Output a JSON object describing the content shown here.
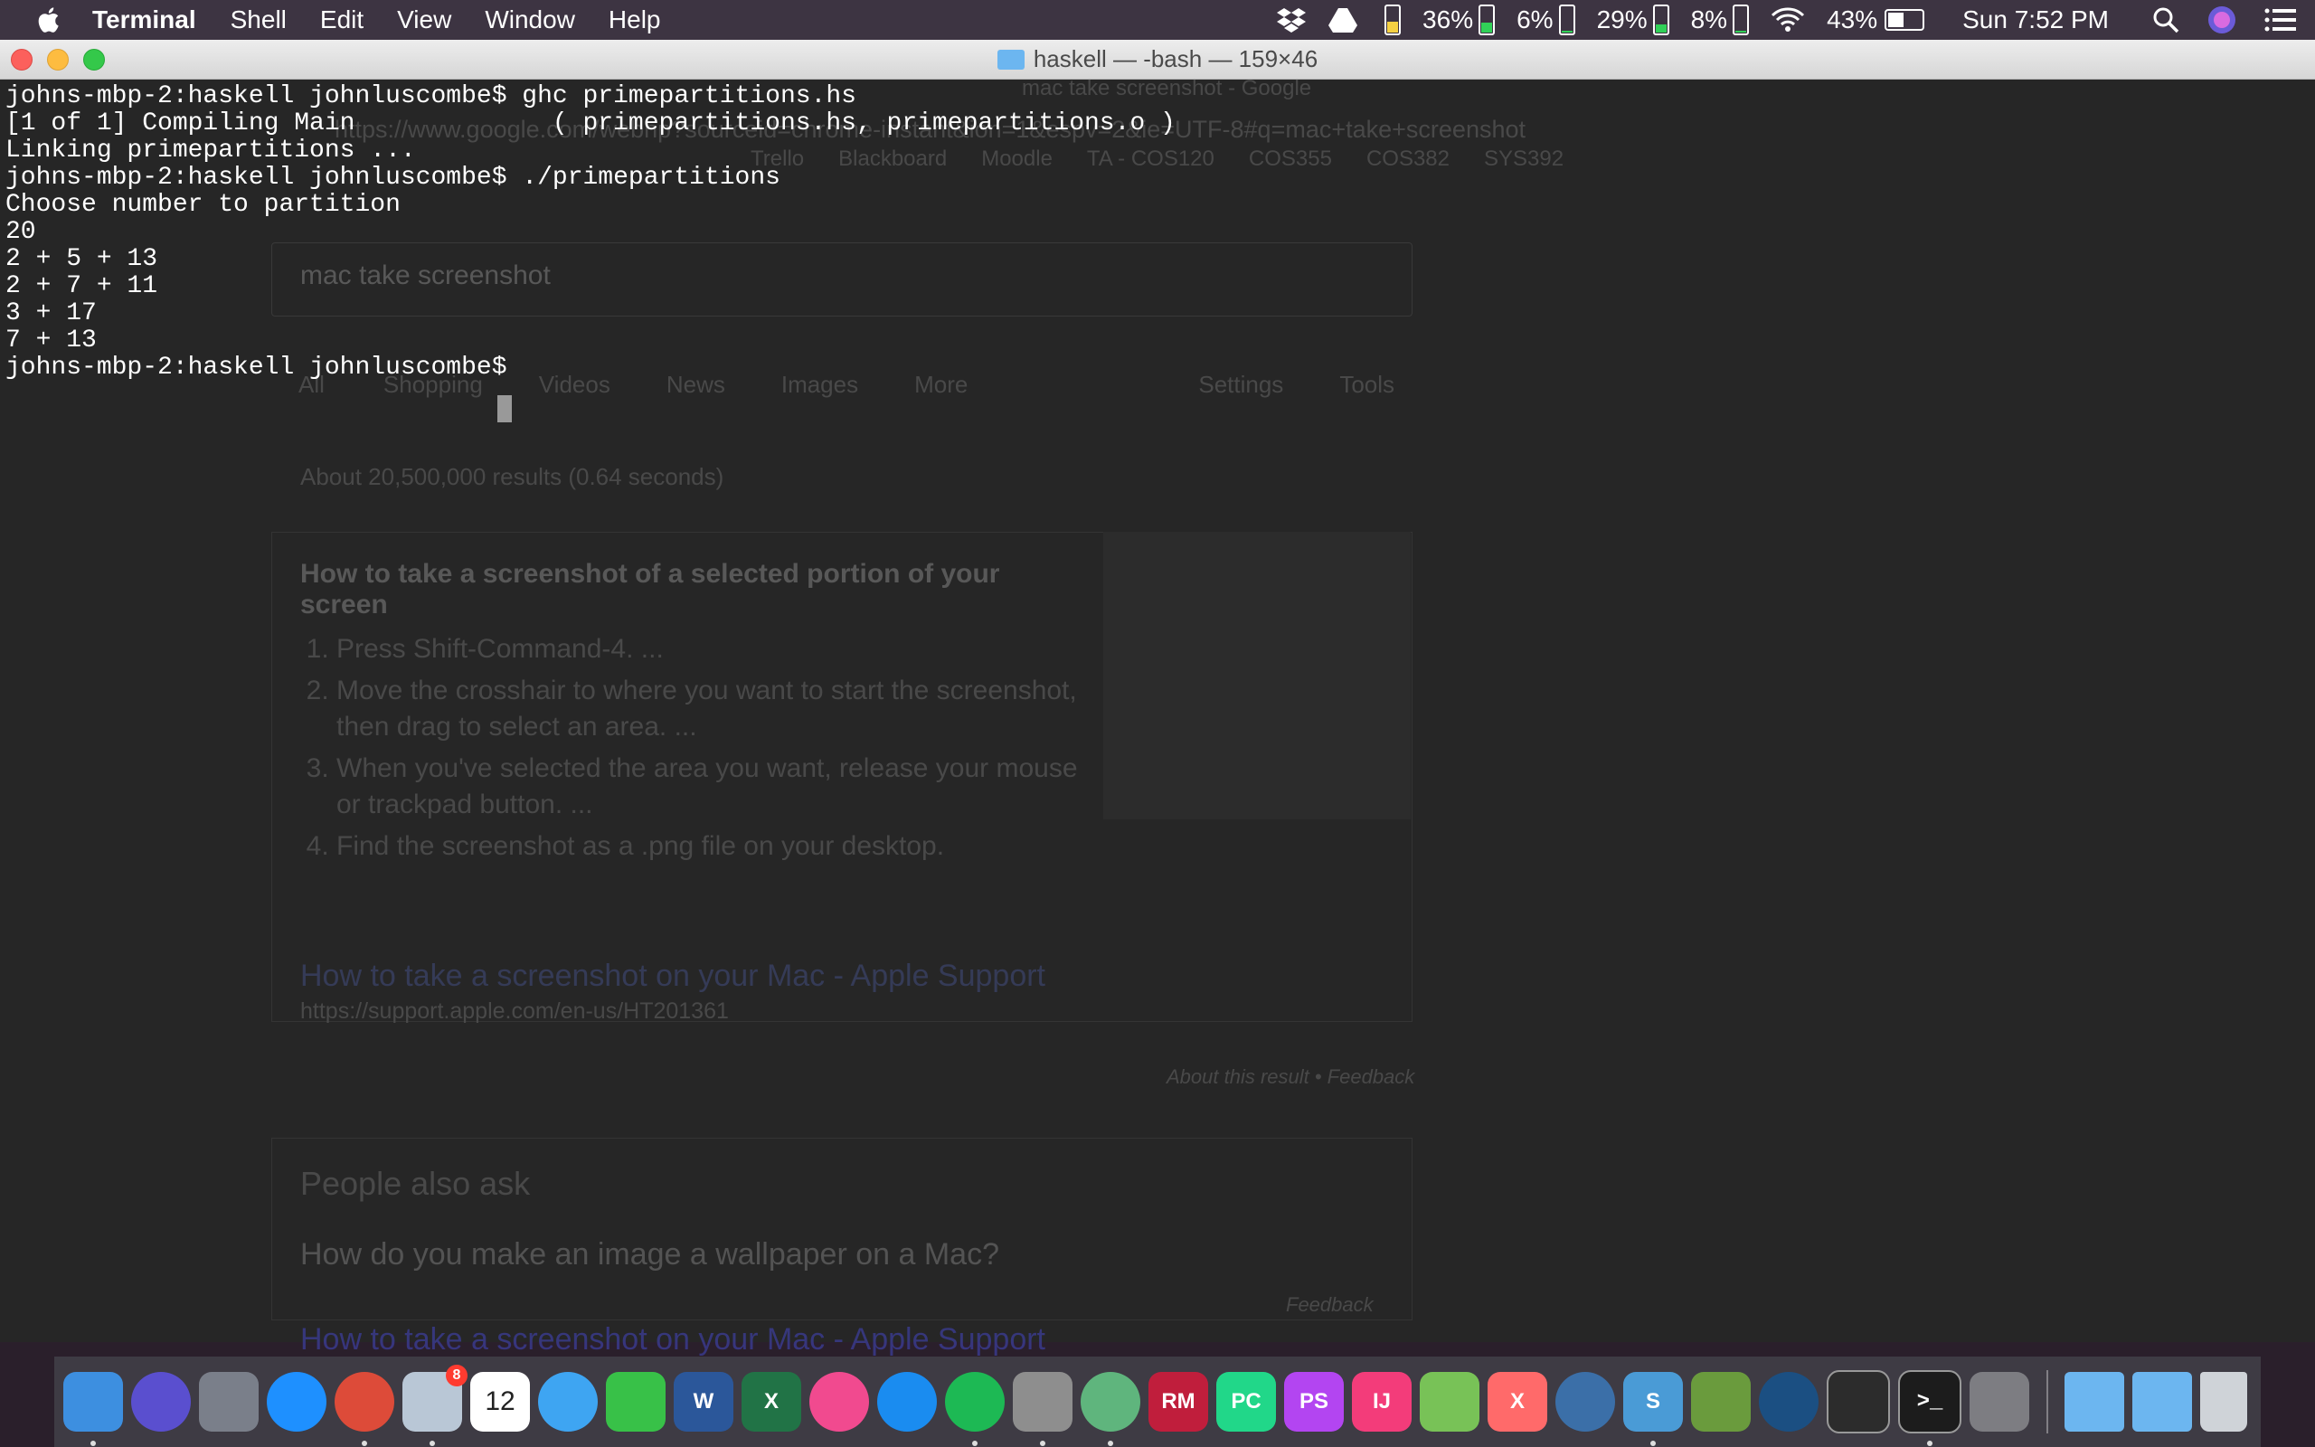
{
  "menubar": {
    "app_name": "Terminal",
    "items": [
      "Shell",
      "Edit",
      "View",
      "Window",
      "Help"
    ],
    "status": {
      "battery1": "36%",
      "battery2": "6%",
      "battery3": "29%",
      "battery4": "8%",
      "main_battery": "43%",
      "clock": "Sun 7:52 PM"
    },
    "icons": [
      "apple-logo",
      "dropbox-icon",
      "drive-icon",
      "wifi-icon",
      "spotlight-icon",
      "siri-icon",
      "notification-center-icon"
    ]
  },
  "window": {
    "title": "haskell — -bash — 159×46"
  },
  "terminal": {
    "lines": [
      "johns-mbp-2:haskell johnluscombe$ ghc primepartitions.hs",
      "[1 of 1] Compiling Main             ( primepartitions.hs, primepartitions.o )",
      "Linking primepartitions ...",
      "johns-mbp-2:haskell johnluscombe$ ./primepartitions",
      "Choose number to partition",
      "20",
      "2 + 5 + 13",
      "2 + 7 + 11",
      "3 + 17",
      "7 + 13",
      "johns-mbp-2:haskell johnluscombe$ "
    ]
  },
  "background_browser": {
    "url": "https://www.google.com/webhp?sourceid=chrome-instant&ion=1&espv=2&ie=UTF-8#q=mac+take+screenshot",
    "tab": "mac take screenshot - Google",
    "bookmarks": [
      "Trello",
      "Blackboard",
      "Moodle",
      "TA - COS120",
      "COS355",
      "COS382",
      "SYS392"
    ],
    "search_query": "mac take screenshot",
    "search_tabs": [
      "All",
      "Shopping",
      "Videos",
      "News",
      "Images",
      "More",
      "Settings",
      "Tools"
    ],
    "results_stats": "About 20,500,000 results (0.64 seconds)",
    "snippet_title": "How to take a screenshot of a selected portion of your screen",
    "snippet_steps": [
      "Press Shift-Command-4. ...",
      "Move the crosshair to where you want to start the screenshot, then drag to select an area. ...",
      "When you've selected the area you want, release your mouse or trackpad button. ...",
      "Find the screenshot as a .png file on your desktop."
    ],
    "result_link": "How to take a screenshot on your Mac - Apple Support",
    "result_url": "https://support.apple.com/en-us/HT201361",
    "about_result": "About this result • Feedback",
    "people_also_ask": "People also ask",
    "paa_question": "How do you make an image a wallpaper on a Mac?",
    "feedback": "Feedback",
    "second_link": "How to take a screenshot on your Mac - Apple Support"
  },
  "dock": {
    "apps": [
      {
        "name": "finder",
        "label": "",
        "color": "#3d8fe0",
        "running": true
      },
      {
        "name": "siri",
        "label": "",
        "color": "#5a4fcf",
        "running": false
      },
      {
        "name": "launchpad",
        "label": "",
        "color": "#7a7f8a",
        "running": false
      },
      {
        "name": "safari",
        "label": "",
        "color": "#1e90ff",
        "running": false
      },
      {
        "name": "chrome",
        "label": "",
        "color": "#dd4b39",
        "running": true
      },
      {
        "name": "mail",
        "label": "",
        "color": "#b9c7d6",
        "running": true
      },
      {
        "name": "calendar",
        "label": "12",
        "color": "#ffffff",
        "running": false
      },
      {
        "name": "messages",
        "label": "",
        "color": "#3ea5f2",
        "running": false
      },
      {
        "name": "facetime",
        "label": "",
        "color": "#38c148",
        "running": false
      },
      {
        "name": "word",
        "label": "W",
        "color": "#2b579a",
        "running": false
      },
      {
        "name": "excel",
        "label": "X",
        "color": "#217346",
        "running": false
      },
      {
        "name": "itunes",
        "label": "",
        "color": "#f14a8f",
        "running": false
      },
      {
        "name": "app-store",
        "label": "",
        "color": "#1a8cf0",
        "running": false
      },
      {
        "name": "spotify",
        "label": "",
        "color": "#1db954",
        "running": true
      },
      {
        "name": "calculator",
        "label": "",
        "color": "#8e8e8e",
        "running": true
      },
      {
        "name": "atom",
        "label": "",
        "color": "#5fb57d",
        "running": true
      },
      {
        "name": "rubymine",
        "label": "RM",
        "color": "#c01e3c",
        "running": false
      },
      {
        "name": "pycharm",
        "label": "PC",
        "color": "#21d789",
        "running": false
      },
      {
        "name": "phpstorm",
        "label": "PS",
        "color": "#b345f1",
        "running": false
      },
      {
        "name": "intellij",
        "label": "IJ",
        "color": "#f33c7a",
        "running": false
      },
      {
        "name": "android-studio",
        "label": "",
        "color": "#78c257",
        "running": false
      },
      {
        "name": "xamarin",
        "label": "X",
        "color": "#ff6a6a",
        "running": false
      },
      {
        "name": "quicktime",
        "label": "",
        "color": "#3b6fa8",
        "running": false
      },
      {
        "name": "sublime",
        "label": "S",
        "color": "#4a9bd6",
        "running": true
      },
      {
        "name": "minecraft",
        "label": "",
        "color": "#6a9b3d",
        "running": false
      },
      {
        "name": "steam",
        "label": "",
        "color": "#1b4f82",
        "running": false
      },
      {
        "name": "activity-monitor",
        "label": "",
        "color": "#2c2c2c",
        "running": false
      },
      {
        "name": "terminal",
        "label": ">_",
        "color": "#1c1c1c",
        "running": true
      },
      {
        "name": "system-preferences",
        "label": "",
        "color": "#7d7d82",
        "running": false
      }
    ],
    "trailing": [
      {
        "name": "documents-folder",
        "color": "#6cb6f0"
      },
      {
        "name": "applications-folder",
        "color": "#6cb6f0"
      },
      {
        "name": "trash",
        "color": "#cfd3d8"
      }
    ],
    "mail_badge": "8"
  }
}
